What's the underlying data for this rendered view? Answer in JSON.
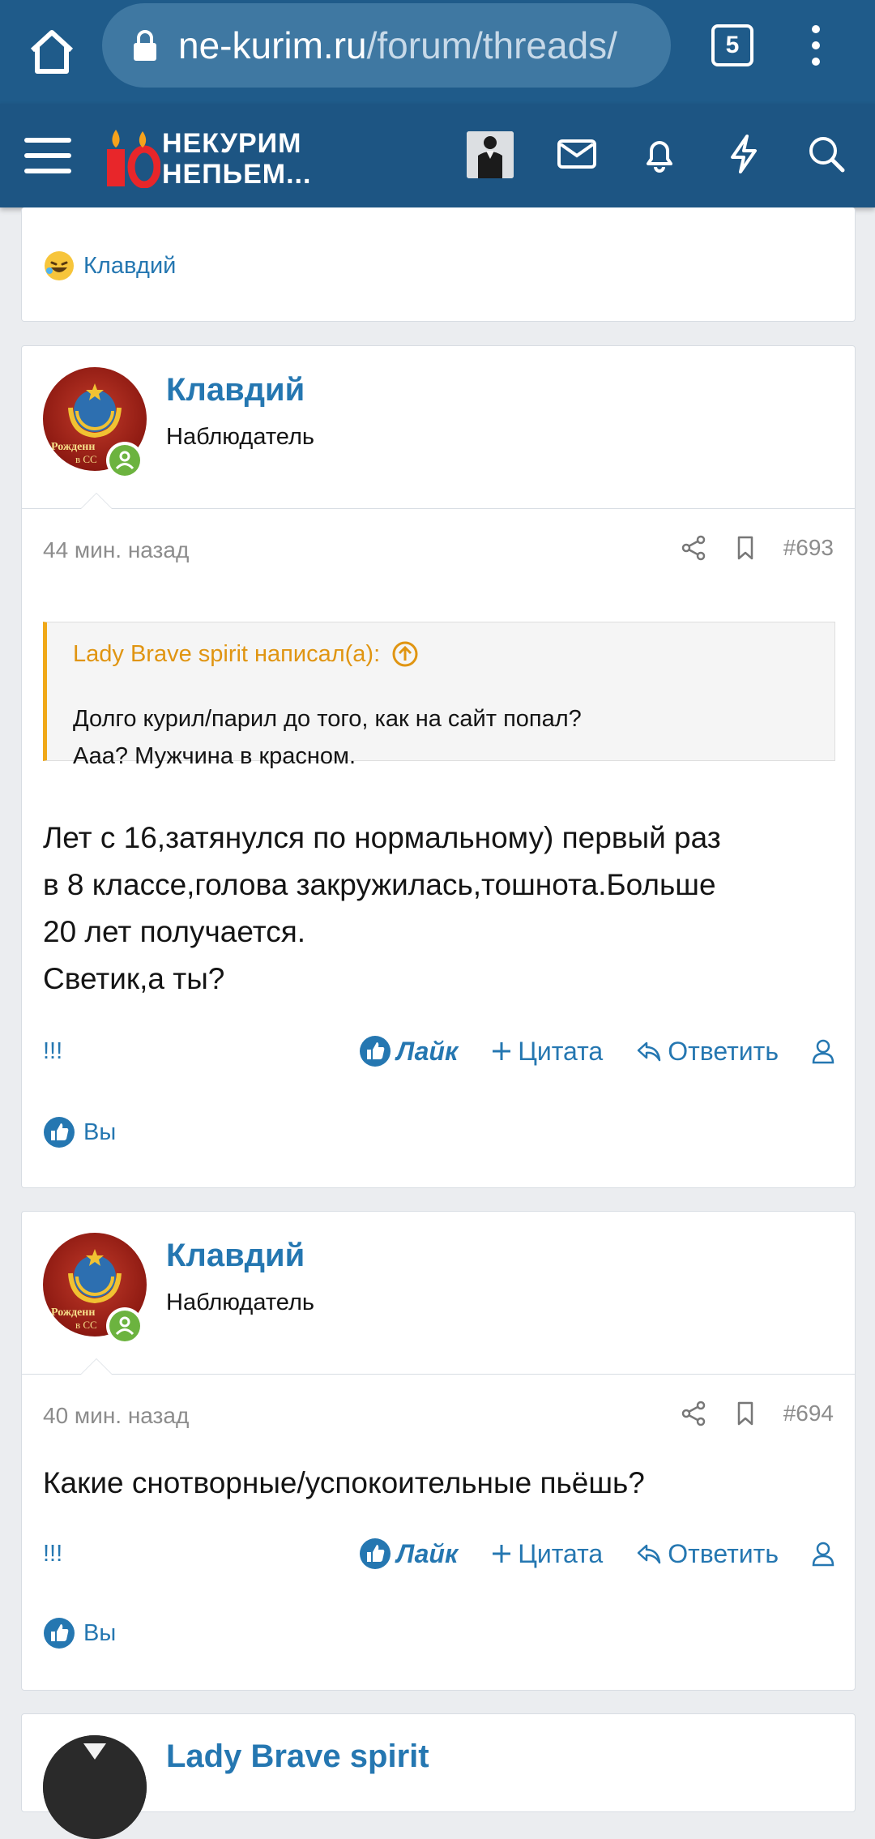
{
  "browser": {
    "url_host": "ne-kurim.ru",
    "url_path": "/forum/threads/",
    "tab_count": "5"
  },
  "site": {
    "logo_line1": "НЕКУРИМ",
    "logo_line2": "НЕПЬЕМ..."
  },
  "card0": {
    "reaction_user": "Клавдий"
  },
  "post693": {
    "username": "Клавдий",
    "usertitle": "Наблюдатель",
    "time": "44 мин. назад",
    "number": "#693",
    "quote_author": "Lady Brave spirit написал(а):",
    "quote_line1": "Долго курил/парил до того, как на сайт попал?",
    "quote_line2": "Ааа? Мужчина в красном.",
    "text_line1": "Лет с 16,затянулся по нормальному) первый раз",
    "text_line2": "в 8 классе,голова закружилась,тошнота.Больше",
    "text_line3": "20 лет получается.",
    "text_line4": "Светик,а ты?",
    "act_bang": "!!!",
    "act_like": "Лайк",
    "act_quote": "Цитата",
    "act_reply": "Ответить",
    "reaction_user": "Вы"
  },
  "post694": {
    "username": "Клавдий",
    "usertitle": "Наблюдатель",
    "time": "40 мин. назад",
    "number": "#694",
    "text_line1": "Какие снотворные/успокоительные пьёшь?",
    "act_bang": "!!!",
    "act_like": "Лайк",
    "act_quote": "Цитата",
    "act_reply": "Ответить",
    "reaction_user": "Вы"
  },
  "post695": {
    "username": "Lady Brave spirit"
  },
  "colors": {
    "header_blue": "#1d5583",
    "link_blue": "#2577b1",
    "quote_orange": "#e09512",
    "online_green": "#6cb33f"
  }
}
